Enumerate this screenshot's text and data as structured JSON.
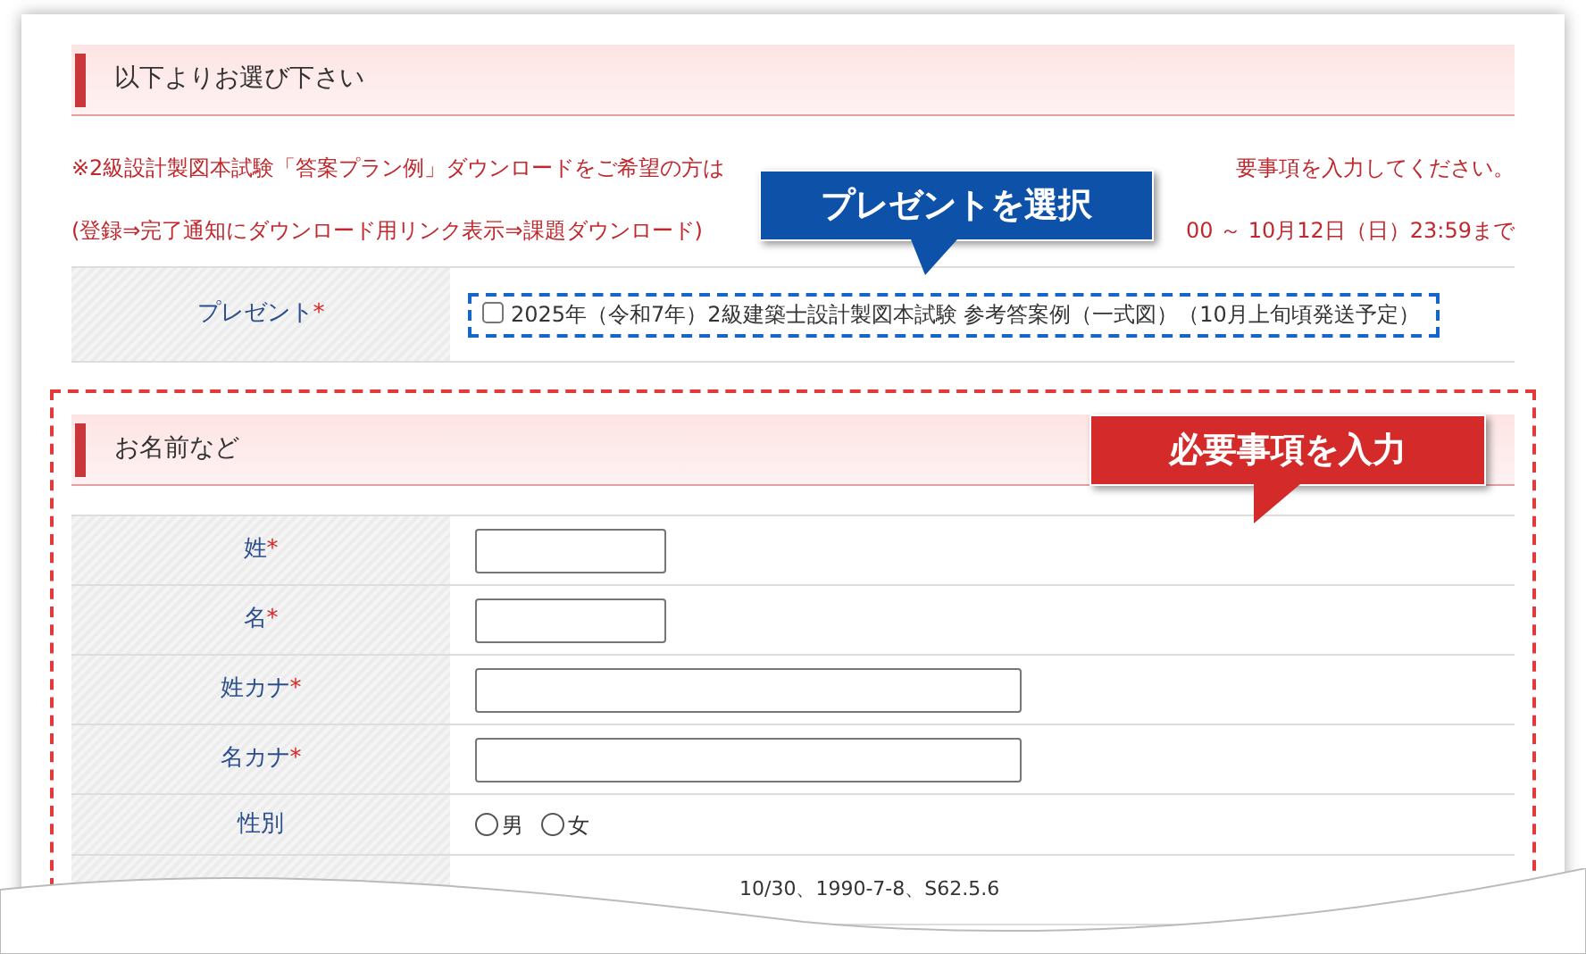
{
  "section1": {
    "title": "以下よりお選び下さい"
  },
  "notice_lines": [
    [
      "※2級設計製図本試験「答案プラン例」ダウンロードをご希望の方は",
      "要事項を入力してください。"
    ],
    [
      "(登録⇒完了通知にダウンロード用リンク表示⇒課題ダウンロード)",
      "00 ～ 10月12日（日）23:59まで"
    ]
  ],
  "present_row": {
    "label": "プレゼント",
    "required_mark": "*",
    "option": {
      "label": "2025年（令和7年）2級建築士設計製図本試験 参考答案例（一式図）（10月上旬頃発送予定）",
      "checked": false
    }
  },
  "section2": {
    "title": "お名前など"
  },
  "fields": [
    {
      "label": "姓",
      "required_mark": "*",
      "kind": "short_text"
    },
    {
      "label": "名",
      "required_mark": "*",
      "kind": "short_text"
    },
    {
      "label": "姓カナ",
      "required_mark": "*",
      "kind": "long_text"
    },
    {
      "label": "名カナ",
      "required_mark": "*",
      "kind": "long_text"
    },
    {
      "label": "性別",
      "kind": "radio",
      "options": [
        {
          "label": "男",
          "selected": false
        },
        {
          "label": "女",
          "selected": false
        }
      ]
    },
    {
      "kind": "hint",
      "hint": "10/30、1990-7-8、S62.5.6"
    }
  ],
  "callouts": [
    {
      "text": "プレゼントを選択",
      "color": "#0d52a8"
    },
    {
      "text": "必要事項を入力",
      "color": "#d42a2a"
    }
  ]
}
